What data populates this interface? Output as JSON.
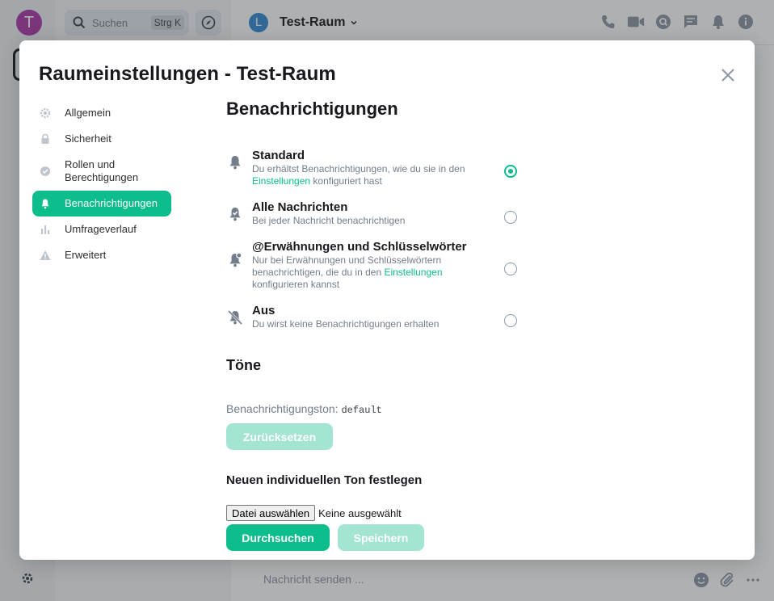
{
  "app": {
    "space_avatar_letter": "T",
    "search_placeholder": "Suchen",
    "search_shortcut": "Strg K",
    "room_avatar_letter": "L",
    "room_name": "Test-Raum",
    "composer_placeholder": "Nachricht senden ..."
  },
  "dialog": {
    "title": "Raumeinstellungen - Test-Raum",
    "tabs": [
      {
        "label": "Allgemein",
        "icon": "gear-icon"
      },
      {
        "label": "Sicherheit",
        "icon": "lock-icon"
      },
      {
        "label": "Rollen und Berechtigungen",
        "icon": "badge-check-icon"
      },
      {
        "label": "Benachrichtigungen",
        "icon": "bell-icon",
        "active": true
      },
      {
        "label": "Umfrageverlauf",
        "icon": "bar-chart-icon"
      },
      {
        "label": "Erweitert",
        "icon": "warning-icon"
      }
    ]
  },
  "notifications": {
    "title": "Benachrichtigungen",
    "options": [
      {
        "title": "Standard",
        "desc_before": "Du erhältst Benachrichtigungen, wie du sie in den ",
        "desc_link": "Einstellungen",
        "desc_after": " konfiguriert hast",
        "checked": true
      },
      {
        "title": "Alle Nachrichten",
        "desc_before": "Bei jeder Nachricht benachrichtigen",
        "desc_link": "",
        "desc_after": "",
        "checked": false
      },
      {
        "title": "@Erwähnungen und Schlüsselwörter",
        "desc_before": "Nur bei Erwähnungen und Schlüsselwörtern benachrichtigen, die du in den ",
        "desc_link": "Einstellungen",
        "desc_after": " konfigurieren kannst",
        "checked": false
      },
      {
        "title": "Aus",
        "desc_before": "Du wirst keine Benachrichtigungen erhalten",
        "desc_link": "",
        "desc_after": "",
        "checked": false
      }
    ]
  },
  "sounds": {
    "title": "Töne",
    "label": "Benachrichtigungston:",
    "value": "default",
    "reset_label": "Zurücksetzen",
    "new_sound_title": "Neuen individuellen Ton festlegen",
    "file_button_label": "Datei auswählen",
    "file_status": "Keine ausgewählt",
    "browse_label": "Durchsuchen",
    "save_label": "Speichern"
  },
  "colors": {
    "accent": "#0dbd8b",
    "accent_disabled": "#a3e5d2",
    "space_avatar": "#ac3ba8",
    "room_avatar": "#368bd6"
  }
}
